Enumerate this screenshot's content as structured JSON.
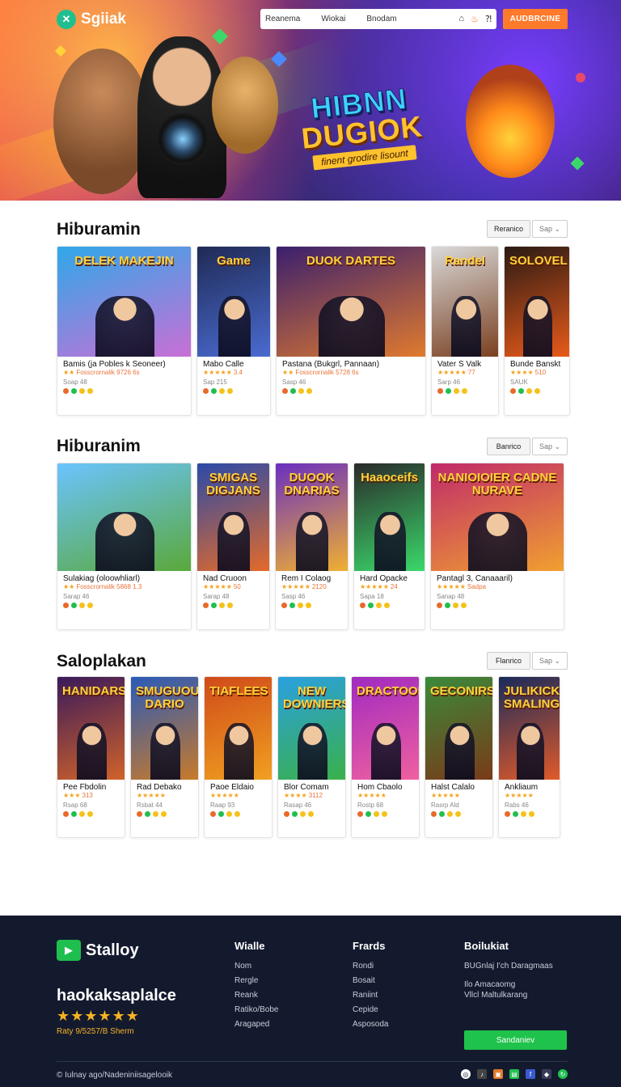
{
  "header": {
    "logo_text": "Sgiiak",
    "nav": [
      "Reanema",
      "Wiokai",
      "Bnodam"
    ],
    "cta": "AUDBRCINE"
  },
  "hero": {
    "title_line1": "HIBNN",
    "title_line2": "DUGIOK",
    "subtitle": "finent grodire lisount"
  },
  "sections": [
    {
      "title": "Hiburamin",
      "filter": "Reranico",
      "sort": "Sap",
      "cards": [
        {
          "thumb_title": "DELEK MAKEJIN",
          "name": "Bamis (ja Pobles k Seoneer)",
          "stars": "★★",
          "meta": "Fosscrornalik 9726 6s",
          "price": "Soap 48",
          "colors": [
            "#2fa8e8",
            "#c96fd6"
          ]
        },
        {
          "thumb_title": "Game",
          "name": "Mabo Calle",
          "stars": "★★★★★",
          "meta": "3.4",
          "price": "Sap 215",
          "colors": [
            "#1f2a55",
            "#4a6bd0"
          ]
        },
        {
          "thumb_title": "DUOK DARTES",
          "name": "Pastana (Bukgrl, Pannaan)",
          "stars": "★★",
          "meta": "Fosscrornalik 5728 6s",
          "price": "Sasp 46",
          "colors": [
            "#3a1f6e",
            "#e07a2e"
          ]
        },
        {
          "thumb_title": "Randel",
          "name": "Vater S Valk",
          "stars": "★★★★★",
          "meta": "77",
          "price": "Sarp 46",
          "colors": [
            "#d9d9d9",
            "#7a4020"
          ]
        },
        {
          "thumb_title": "SOLOVEL",
          "name": "Bunde Banskt",
          "stars": "★★★★",
          "meta": "510",
          "price": "SAUK",
          "colors": [
            "#2a1a14",
            "#e85a1a"
          ]
        }
      ]
    },
    {
      "title": "Hiburanim",
      "filter": "Banrico",
      "sort": "Sap",
      "cards": [
        {
          "thumb_title": "",
          "name": "Sulakiag (oloowhliarl)",
          "stars": "★★",
          "meta": "Fosscrornalik 5868 1.3",
          "price": "Sarap 46",
          "colors": [
            "#6bc4ff",
            "#5aa83a"
          ]
        },
        {
          "thumb_title": "SMIGAS DIGJANS",
          "name": "Nad Cruoon",
          "stars": "★★★★★",
          "meta": "50",
          "price": "Sarap 48",
          "colors": [
            "#2a4aa8",
            "#e46a2a"
          ]
        },
        {
          "thumb_title": "DUOOK DNARIAS",
          "name": "Rem I Colaog",
          "stars": "★★★★★",
          "meta": "2120",
          "price": "Sasp 46",
          "colors": [
            "#6a2fc0",
            "#f0b030"
          ]
        },
        {
          "thumb_title": "Haaoceifs",
          "name": "Hard Opacke",
          "stars": "★★★★★",
          "meta": "24",
          "price": "Sapa 18",
          "colors": [
            "#2a2a2a",
            "#3ad86a"
          ]
        },
        {
          "thumb_title": "NANIOIOIER CADNE NURAVE",
          "name": "Pantagl 3, Canaaaril)",
          "stars": "★★★★★",
          "meta": "Sadpa",
          "price": "Sanap 48",
          "colors": [
            "#c02a6a",
            "#f0a030"
          ]
        }
      ]
    },
    {
      "title": "Saloplakan",
      "filter": "Flanrico",
      "sort": "Sap",
      "cards": [
        {
          "thumb_title": "HANIDARS",
          "name": "Pee Fbdolin",
          "stars": "★★★",
          "meta": "313",
          "price": "Rsap 68",
          "colors": [
            "#3a1a5a",
            "#d0622a"
          ]
        },
        {
          "thumb_title": "SMUGUOUK DARIO",
          "name": "Rad Debako",
          "stars": "★★★★★",
          "meta": "",
          "price": "Rsbat 44",
          "colors": [
            "#2a5ab8",
            "#c87a2a"
          ]
        },
        {
          "thumb_title": "TIAFLEES",
          "name": "Paoe Eldaio",
          "stars": "★★★★★",
          "meta": "",
          "price": "Raap 93",
          "colors": [
            "#d04a1a",
            "#f0a020"
          ]
        },
        {
          "thumb_title": "NEW DOWNIERS",
          "name": "Blor Comam",
          "stars": "★★★★",
          "meta": "3112",
          "price": "Rasap 46",
          "colors": [
            "#2aa0e0",
            "#3ab04a"
          ]
        },
        {
          "thumb_title": "DRACTOOK",
          "name": "Hom Cbaolo",
          "stars": "★★★★★",
          "meta": "",
          "price": "Rostp 68",
          "colors": [
            "#a02ac0",
            "#f060a0"
          ]
        },
        {
          "thumb_title": "GECONIRS",
          "name": "Halst Calalo",
          "stars": "★★★★★",
          "meta": "",
          "price": "Rasrp Ald",
          "colors": [
            "#3a8a3a",
            "#7a3a1a"
          ]
        },
        {
          "thumb_title": "JULIKICK SMALING",
          "name": "Ankliaum",
          "stars": "★★★★★",
          "meta": "",
          "price": "Rabs 46",
          "colors": [
            "#1a2a5a",
            "#e05a2a"
          ]
        }
      ]
    }
  ],
  "footer": {
    "logo_text": "Stalloy",
    "brand": "haokaksaplalce",
    "stars": "★★★★★★",
    "rating": "Raty 9/5257/B Sherm",
    "columns": [
      {
        "title": "Wialle",
        "links": [
          "Nom",
          "Rergle",
          "Reank",
          "Ratiko/Bobe",
          "Aragaped"
        ]
      },
      {
        "title": "Frards",
        "links": [
          "Rondi",
          "Bosait",
          "Raniint",
          "Cepide",
          "Asposoda"
        ]
      },
      {
        "title": "Boilukiat",
        "links": [
          "BUGnlaj I'ch Daragmaas",
          "Ilo Amacaomg",
          "Vllcl Maltulkarang"
        ]
      }
    ],
    "button": "Sandaniev",
    "copyright": "© Iulnay ago/Nadeniniisagelooik"
  },
  "colors": {
    "accent": "#ff7a2a",
    "footer_bg": "#141a2e",
    "footer_button": "#1fc24a",
    "star": "#f4a21b"
  }
}
